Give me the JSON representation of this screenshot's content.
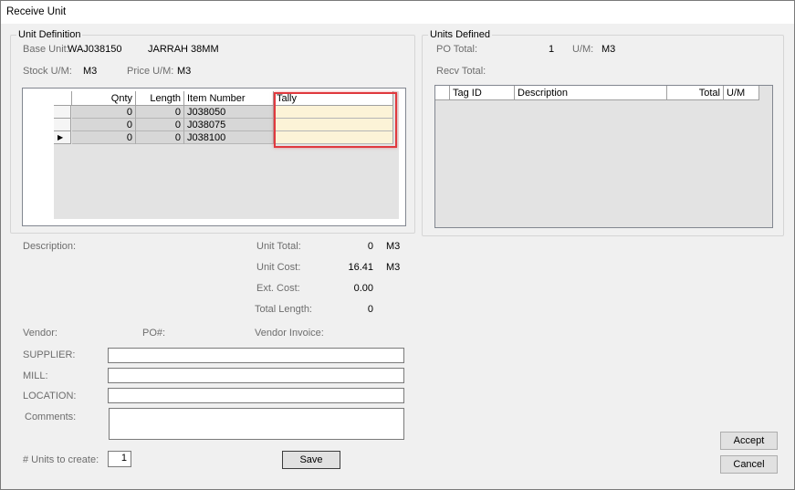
{
  "window": {
    "title": "Receive Unit"
  },
  "unit_definition": {
    "group_title": "Unit Definition",
    "base_unit_label": "Base Unit:",
    "base_unit_value": "WAJ038150",
    "base_unit_desc": "JARRAH 38MM",
    "stock_um_label": "Stock U/M:",
    "stock_um_value": "M3",
    "price_um_label": "Price U/M:",
    "price_um_value": "M3",
    "grid": {
      "headers": [
        "Qnty",
        "Length",
        "Item Number",
        "Tally"
      ],
      "rows": [
        {
          "qnty": "0",
          "length": "0",
          "item": "J038050",
          "tally": ""
        },
        {
          "qnty": "0",
          "length": "0",
          "item": "J038075",
          "tally": ""
        },
        {
          "qnty": "0",
          "length": "0",
          "item": "J038100",
          "tally": ""
        }
      ],
      "current_row_marker": "▶"
    }
  },
  "summary": {
    "description_label": "Description:",
    "unit_total_label": "Unit Total:",
    "unit_total_value": "0",
    "unit_total_um": "M3",
    "unit_cost_label": "Unit Cost:",
    "unit_cost_value": "16.41",
    "unit_cost_um": "M3",
    "ext_cost_label": "Ext. Cost:",
    "ext_cost_value": "0.00",
    "total_length_label": "Total Length:",
    "total_length_value": "0"
  },
  "vendor": {
    "vendor_label": "Vendor:",
    "po_label": "PO#:",
    "vendor_invoice_label": "Vendor Invoice:",
    "supplier_label": "SUPPLIER:",
    "supplier_value": "",
    "mill_label": "MILL:",
    "mill_value": "",
    "location_label": "LOCATION:",
    "location_value": "",
    "comments_label": "Comments:",
    "comments_value": ""
  },
  "footer": {
    "units_to_create_label": "# Units to create:",
    "units_to_create_value": "1",
    "save_label": "Save",
    "accept_label": "Accept",
    "cancel_label": "Cancel"
  },
  "units_defined": {
    "group_title": "Units Defined",
    "po_total_label": "PO Total:",
    "po_total_value": "1",
    "um_label": "U/M:",
    "um_value": "M3",
    "recv_total_label": "Recv Total:",
    "grid_headers": [
      "Tag ID",
      "Description",
      "Total",
      "U/M"
    ]
  },
  "colors": {
    "highlight": "#e0393e",
    "tally_cell": "#fcf3d7",
    "window_bg": "#f0f0f0"
  }
}
